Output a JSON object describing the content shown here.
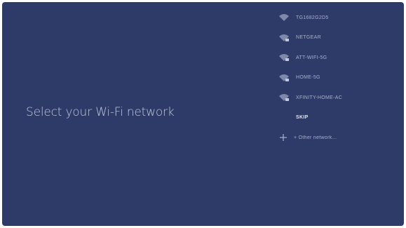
{
  "page": {
    "title": "Select your Wi-Fi network"
  },
  "networks": [
    {
      "name": "TG1682G2D5",
      "icon": "wifi-icon"
    },
    {
      "name": "NETGEAR",
      "icon": "wifi-lock-icon"
    },
    {
      "name": "ATT-WIFI-5G",
      "icon": "wifi-lock-icon"
    },
    {
      "name": "HOME-5G",
      "icon": "wifi-lock-icon"
    },
    {
      "name": "XFINITY-HOME-AC",
      "icon": "wifi-lock-icon"
    }
  ],
  "selected_item": {
    "name": "SKIP"
  },
  "other_network": {
    "label": "+ Other network...",
    "icon": "plus-icon"
  },
  "colors": {
    "background": "#2e3a68",
    "text": "#c3c9dd",
    "list_text": "#aab2cc"
  }
}
